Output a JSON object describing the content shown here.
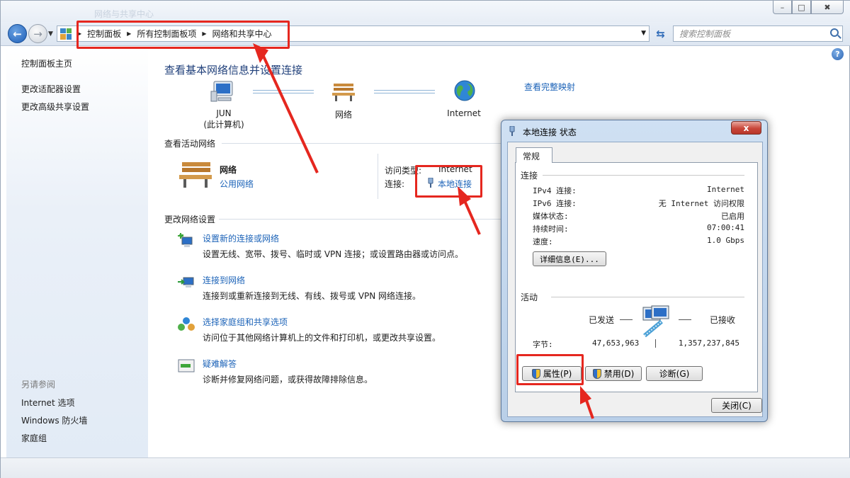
{
  "window": {
    "title_ghost": "网络与共享中心",
    "minimize_glyph": "–",
    "maximize_glyph": "□",
    "close_glyph": "✖"
  },
  "nav": {
    "back_glyph": "←",
    "forward_glyph": "→",
    "breadcrumb": [
      "控制面板",
      "所有控制面板项",
      "网络和共享中心"
    ],
    "search_placeholder": "搜索控制面板"
  },
  "sidebar": {
    "items": [
      "控制面板主页",
      "更改适配器设置",
      "更改高级共享设置"
    ],
    "see_also_heading": "另请参阅",
    "see_also": [
      "Internet 选项",
      "Windows 防火墙",
      "家庭组"
    ]
  },
  "main": {
    "title": "查看基本网络信息并设置连接",
    "map": {
      "computer_name": "JUN",
      "computer_sub": "(此计算机)",
      "network": "网络",
      "internet": "Internet",
      "full_map_link": "查看完整映射"
    },
    "active_heading": "查看活动网络",
    "active": {
      "name": "网络",
      "type": "公用网络",
      "access_label": "访问类型:",
      "access_value": "Internet",
      "conn_label": "连接:",
      "conn_value": "本地连接"
    },
    "change_heading": "更改网络设置",
    "tasks": [
      {
        "link": "设置新的连接或网络",
        "desc": "设置无线、宽带、拨号、临时或 VPN 连接；或设置路由器或访问点。"
      },
      {
        "link": "连接到网络",
        "desc": "连接到或重新连接到无线、有线、拨号或 VPN 网络连接。"
      },
      {
        "link": "选择家庭组和共享选项",
        "desc": "访问位于其他网络计算机上的文件和打印机，或更改共享设置。"
      },
      {
        "link": "疑难解答",
        "desc": "诊断并修复网络问题，或获得故障排除信息。"
      }
    ],
    "help_glyph": "?"
  },
  "dialog": {
    "title": "本地连接 状态",
    "close_glyph": "x",
    "tab": "常规",
    "conn_heading": "连接",
    "rows": [
      {
        "label": "IPv4 连接:",
        "value": "Internet"
      },
      {
        "label": "IPv6 连接:",
        "value": "无 Internet 访问权限"
      },
      {
        "label": "媒体状态:",
        "value": "已启用"
      },
      {
        "label": "持续时间:",
        "value": "07:00:41"
      },
      {
        "label": "速度:",
        "value": "1.0 Gbps"
      }
    ],
    "details_button": "详细信息(E)...",
    "activity_heading": "活动",
    "sent_label": "已发送",
    "received_label": "已接收",
    "bytes_label": "字节:",
    "bytes_sent": "47,653,963",
    "bytes_received": "1,357,237,845",
    "properties_button": "属性(P)",
    "disable_button": "禁用(D)",
    "diagnose_button": "诊断(G)",
    "close_button": "关闭(C)"
  },
  "colors": {
    "link": "#1c63b8",
    "title": "#1f3f7a",
    "annotation": "#e5271f"
  }
}
